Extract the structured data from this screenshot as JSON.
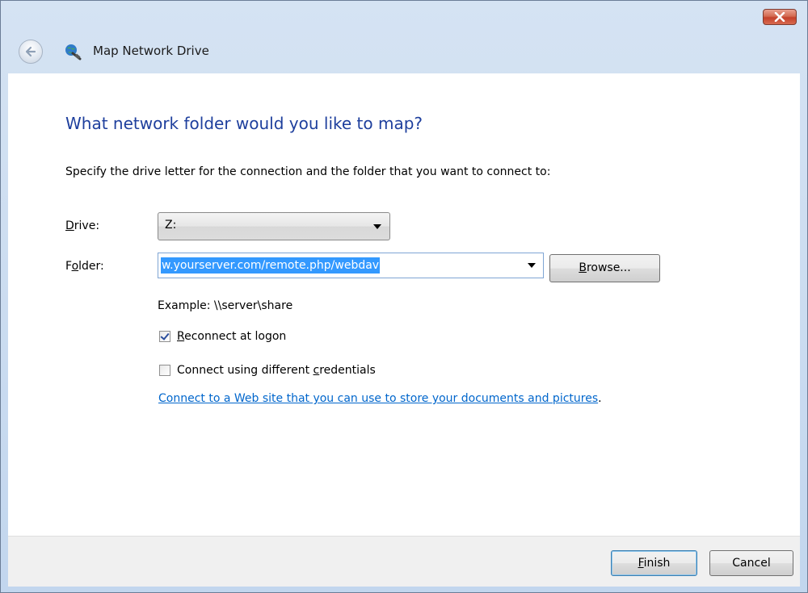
{
  "window": {
    "title": "Map Network Drive",
    "close_icon": "close-icon",
    "colors": {
      "close_button": "#c4402a",
      "heading": "#1e3f9d",
      "link": "#0066cc",
      "selection": "#3399ff"
    }
  },
  "page": {
    "heading": "What network folder would you like to map?",
    "instruction": "Specify the drive letter for the connection and the folder that you want to connect to:"
  },
  "drive": {
    "label_accel": "D",
    "label_rest": "rive:",
    "value": "Z:"
  },
  "folder": {
    "label_pre": "F",
    "label_accel": "o",
    "label_post": "lder:",
    "value": "w.yourserver.com/remote.php/webdav",
    "browse_accel": "B",
    "browse_rest": "rowse...",
    "example": "Example: \\\\server\\share"
  },
  "options": {
    "reconnect": {
      "checked": true,
      "accel": "R",
      "rest": "econnect at logon"
    },
    "credentials": {
      "checked": false,
      "pre": "Connect using different ",
      "accel": "c",
      "post": "redentials"
    }
  },
  "link": {
    "text": "Connect to a Web site that you can use to store your documents and pictures",
    "suffix": "."
  },
  "footer": {
    "finish_accel": "F",
    "finish_rest": "inish",
    "cancel": "Cancel"
  }
}
